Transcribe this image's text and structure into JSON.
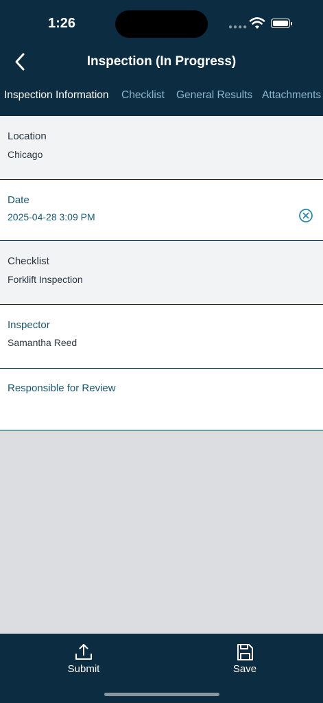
{
  "status_bar": {
    "time": "1:26"
  },
  "header": {
    "title": "Inspection (In Progress)"
  },
  "tabs": [
    {
      "label": "Inspection Information",
      "active": true
    },
    {
      "label": "Checklist",
      "active": false
    },
    {
      "label": "General Results",
      "active": false
    },
    {
      "label": "Attachments",
      "active": false
    }
  ],
  "fields": {
    "location": {
      "label": "Location",
      "value": "Chicago"
    },
    "date": {
      "label": "Date",
      "value": "2025-04-28 3:09 PM"
    },
    "checklist": {
      "label": "Checklist",
      "value": "Forklift Inspection"
    },
    "inspector": {
      "label": "Inspector",
      "value": "Samantha Reed"
    },
    "responsible": {
      "label": "Responsible for Review",
      "value": ""
    }
  },
  "actions": {
    "submit_label": "Submit",
    "save_label": "Save"
  },
  "colors": {
    "header_bg": "#0c2d41",
    "accent": "#1a5876",
    "tab_inactive": "#8fb6cc",
    "clear_icon": "#2a8ab0"
  }
}
